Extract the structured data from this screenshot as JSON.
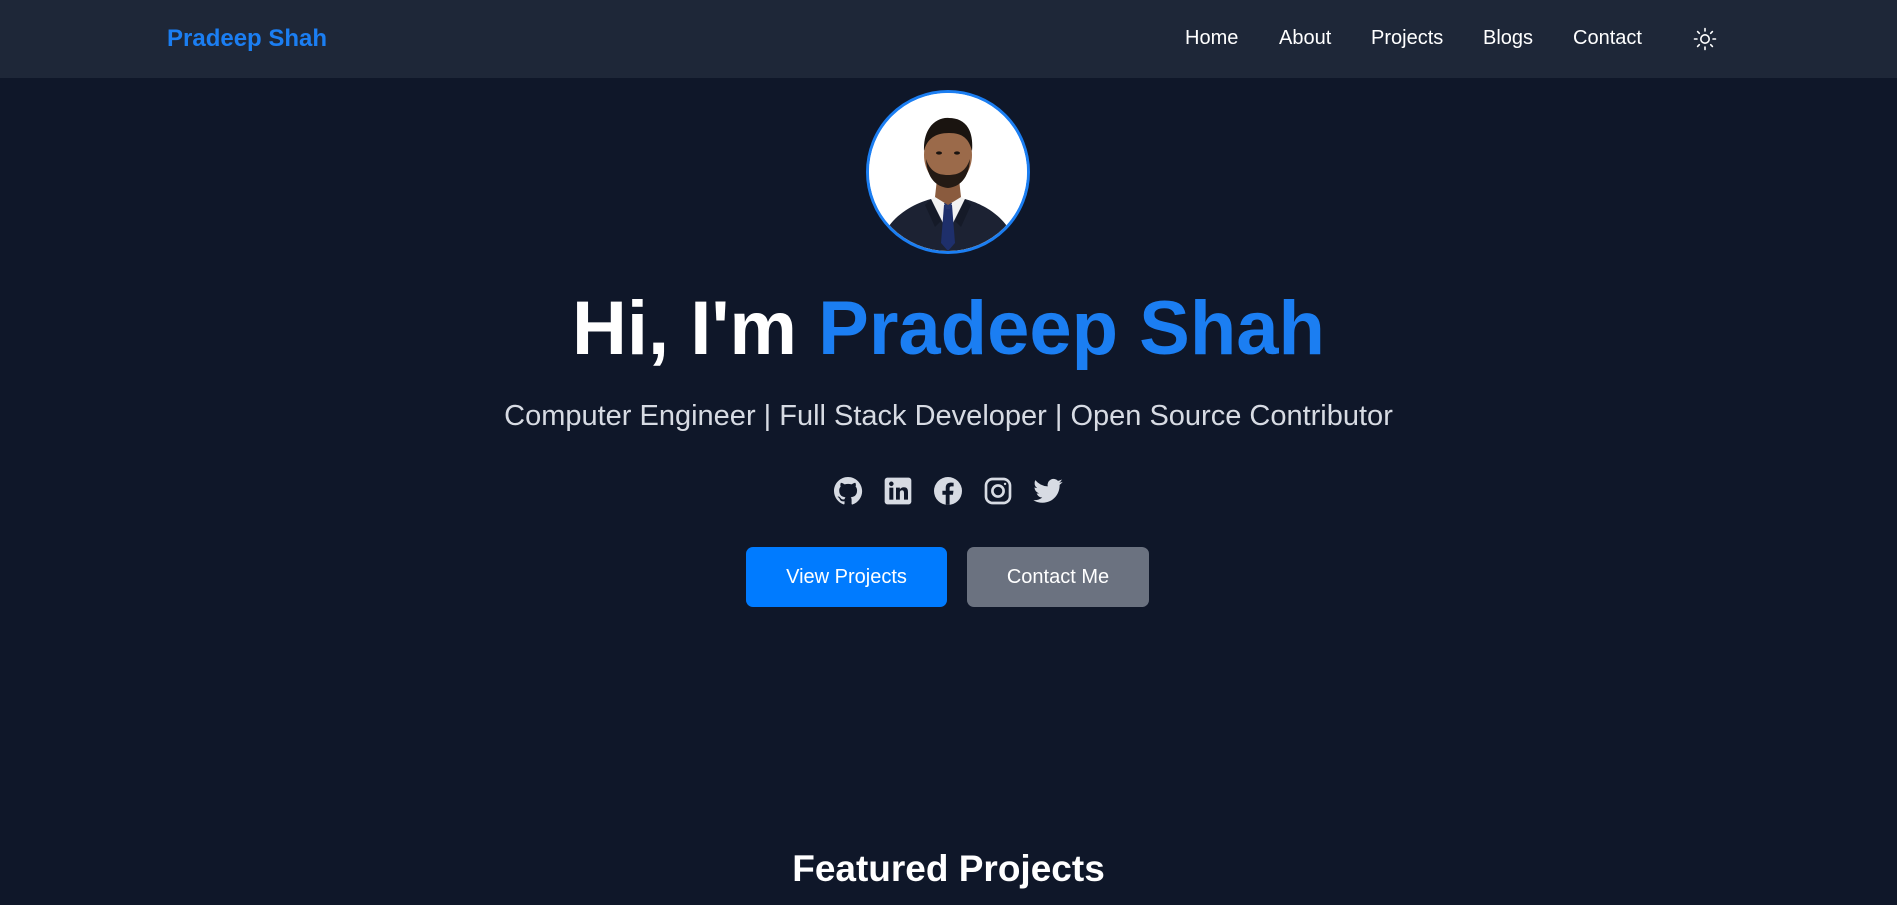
{
  "navbar": {
    "brand": "Pradeep Shah",
    "links": [
      {
        "label": "Home"
      },
      {
        "label": "About"
      },
      {
        "label": "Projects"
      },
      {
        "label": "Blogs"
      },
      {
        "label": "Contact"
      }
    ],
    "theme_toggle_icon": "sun-icon"
  },
  "hero": {
    "avatar_alt": "Profile photo",
    "greeting": "Hi, I'm ",
    "name": "Pradeep Shah",
    "subtitle": "Computer Engineer | Full Stack Developer | Open Source Contributor",
    "socials": [
      "github-icon",
      "linkedin-icon",
      "facebook-icon",
      "instagram-icon",
      "twitter-icon"
    ],
    "primary_button": "View Projects",
    "secondary_button": "Contact Me"
  },
  "featured": {
    "title": "Featured Projects"
  },
  "colors": {
    "accent": "#1b7ef2",
    "background": "#0f1729",
    "navbar": "#1e2738",
    "secondary_button": "#6b7280"
  }
}
